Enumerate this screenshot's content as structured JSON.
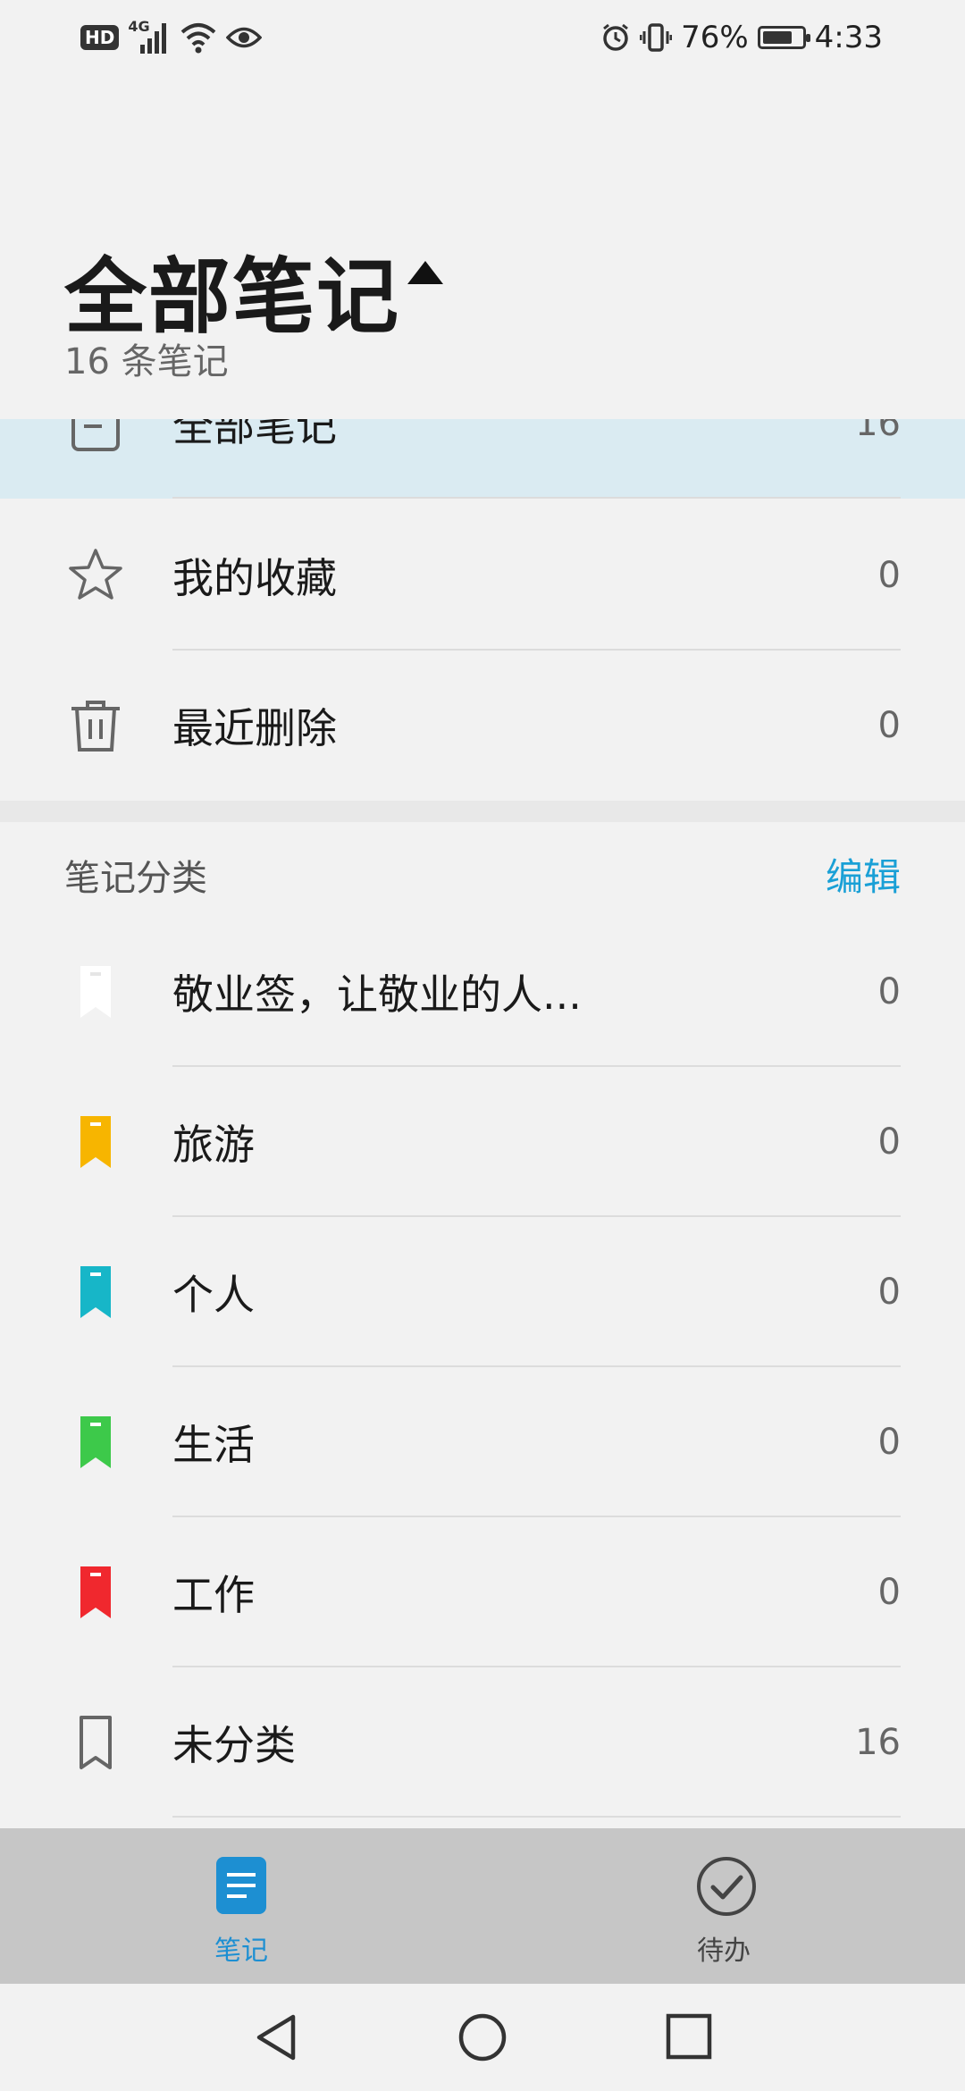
{
  "status_bar": {
    "left_icons": [
      "hd-icon",
      "signal-4g-icon",
      "wifi-icon",
      "eye-icon"
    ],
    "network_label": "4G",
    "hd_label": "HD",
    "battery_percent": "76%",
    "battery_level": 0.76,
    "time": "4:33"
  },
  "header": {
    "title": "全部笔记",
    "subtitle": "16 条笔记"
  },
  "system_items": [
    {
      "label": "全部笔记",
      "count": "16",
      "icon": "note-icon",
      "selected": true
    },
    {
      "label": "我的收藏",
      "count": "0",
      "icon": "star-icon"
    },
    {
      "label": "最近删除",
      "count": "0",
      "icon": "trash-icon"
    }
  ],
  "categories_section": {
    "title": "笔记分类",
    "edit_label": "编辑"
  },
  "categories": [
    {
      "label": "敬业签，让敬业的人...",
      "count": "0",
      "color": "#ffffff"
    },
    {
      "label": "旅游",
      "count": "0",
      "color": "#f7b500"
    },
    {
      "label": "个人",
      "count": "0",
      "color": "#17b6c8"
    },
    {
      "label": "生活",
      "count": "0",
      "color": "#3dc94a"
    },
    {
      "label": "工作",
      "count": "0",
      "color": "#f0282e"
    },
    {
      "label": "未分类",
      "count": "16",
      "color": "outline"
    }
  ],
  "tabbar": {
    "notes_label": "笔记",
    "todo_label": "待办",
    "active_color": "#1d8fd2"
  }
}
